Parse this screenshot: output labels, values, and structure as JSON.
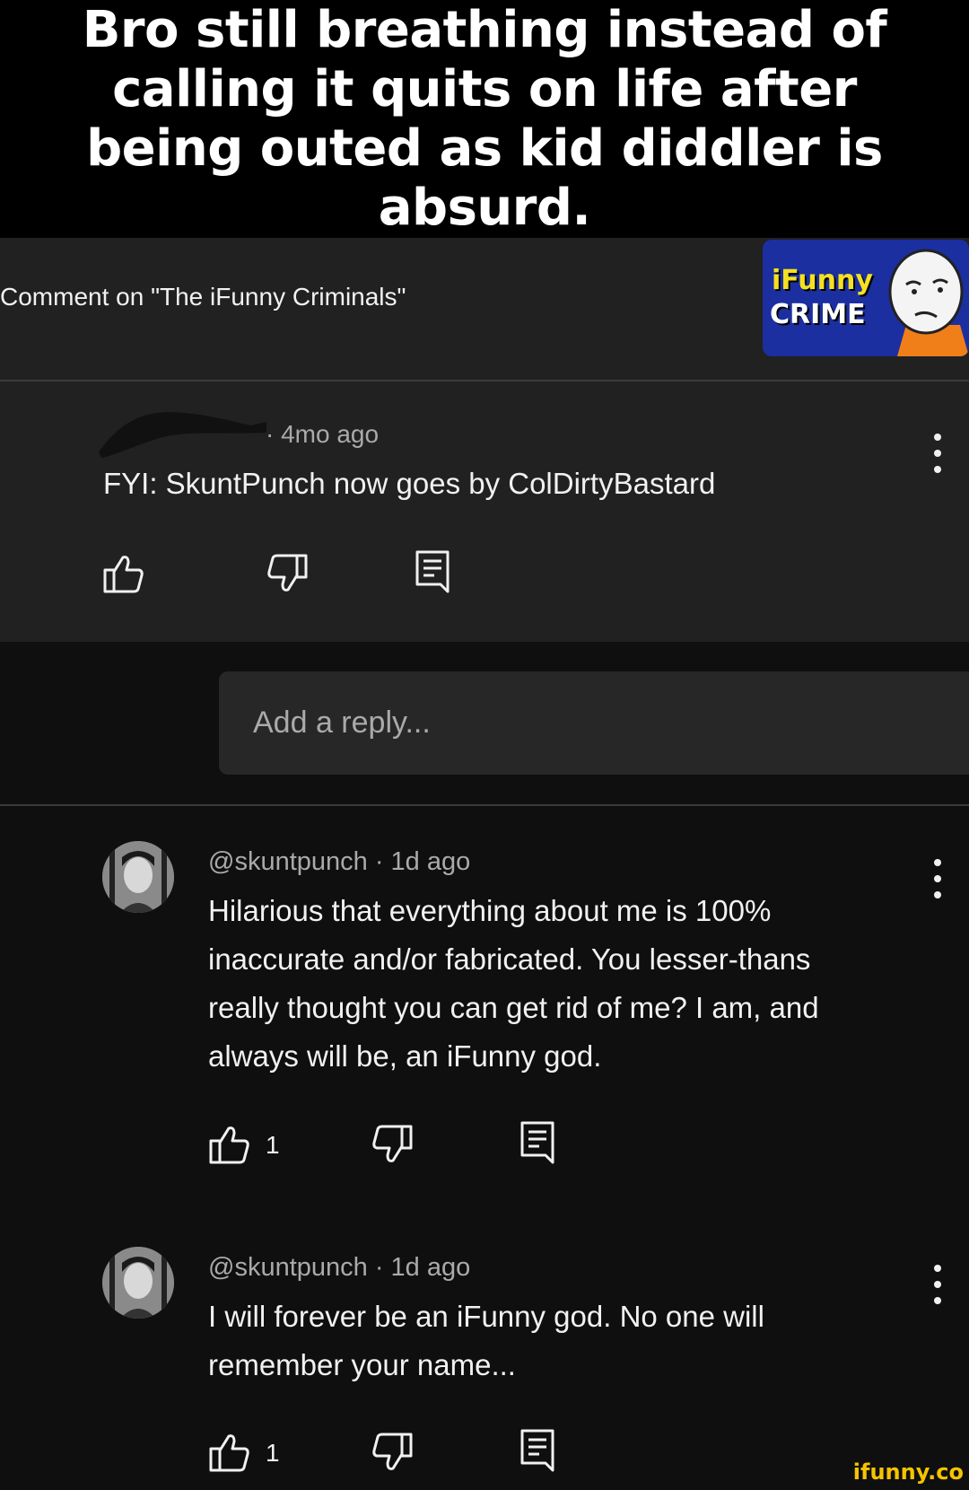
{
  "caption": "Bro still breathing instead of calling it quits on life after being outed as kid diddler is absurd.",
  "header": {
    "title": "Comment on \"The iFunny Criminals\"",
    "thumbnail": {
      "line1": "iFunny",
      "line2": "CRIME"
    }
  },
  "top_comment": {
    "time": "· 4mo ago",
    "text": "FYI: SkuntPunch now goes by ColDirtyBastard"
  },
  "reply_box": {
    "placeholder": "Add a reply..."
  },
  "replies": [
    {
      "author": "@skuntpunch",
      "time": "· 1d ago",
      "lines": [
        "Hilarious that everything about me is 100%",
        "inaccurate and/or fabricated. You lesser-thans",
        "really thought you can get rid of me? I am, and",
        "always will be, an iFunny god."
      ],
      "likes": "1"
    },
    {
      "author": "@skuntpunch",
      "time": "· 1d ago",
      "lines": [
        "I will forever be an iFunny god. No one will",
        "remember your name..."
      ],
      "likes": "1"
    }
  ],
  "watermark": "ifunny.co",
  "colors": {
    "background": "#0f0f0f",
    "panel": "#212121",
    "input": "#272727",
    "muted_text": "#aaaaaa",
    "text": "#f1f1f1",
    "watermark": "#f5c400"
  }
}
